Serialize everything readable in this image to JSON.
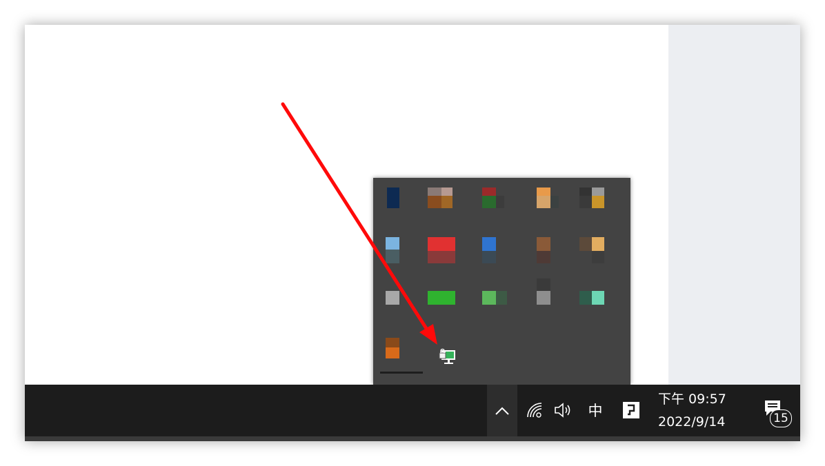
{
  "taskbar": {
    "show_hidden_icons": "chevron-up-icon",
    "network_icon": "wifi-icon",
    "volume_icon": "speaker-icon",
    "ime_label": "中",
    "input_tool_icon": "input-mode-icon",
    "clock_time": "下午 09:57",
    "clock_date": "2022/9/14",
    "notification_count": "15"
  },
  "flyout": {
    "title": "hidden-tray-icons",
    "highlighted_icon": "network-lock-monitor-icon",
    "icon_count": 17
  },
  "annotation": {
    "arrow_color": "#ff0000"
  },
  "colors": {
    "taskbar_bg": "#1c1c1c",
    "flyout_bg": "#434343",
    "desktop_panel_bg": "#eceef2"
  }
}
